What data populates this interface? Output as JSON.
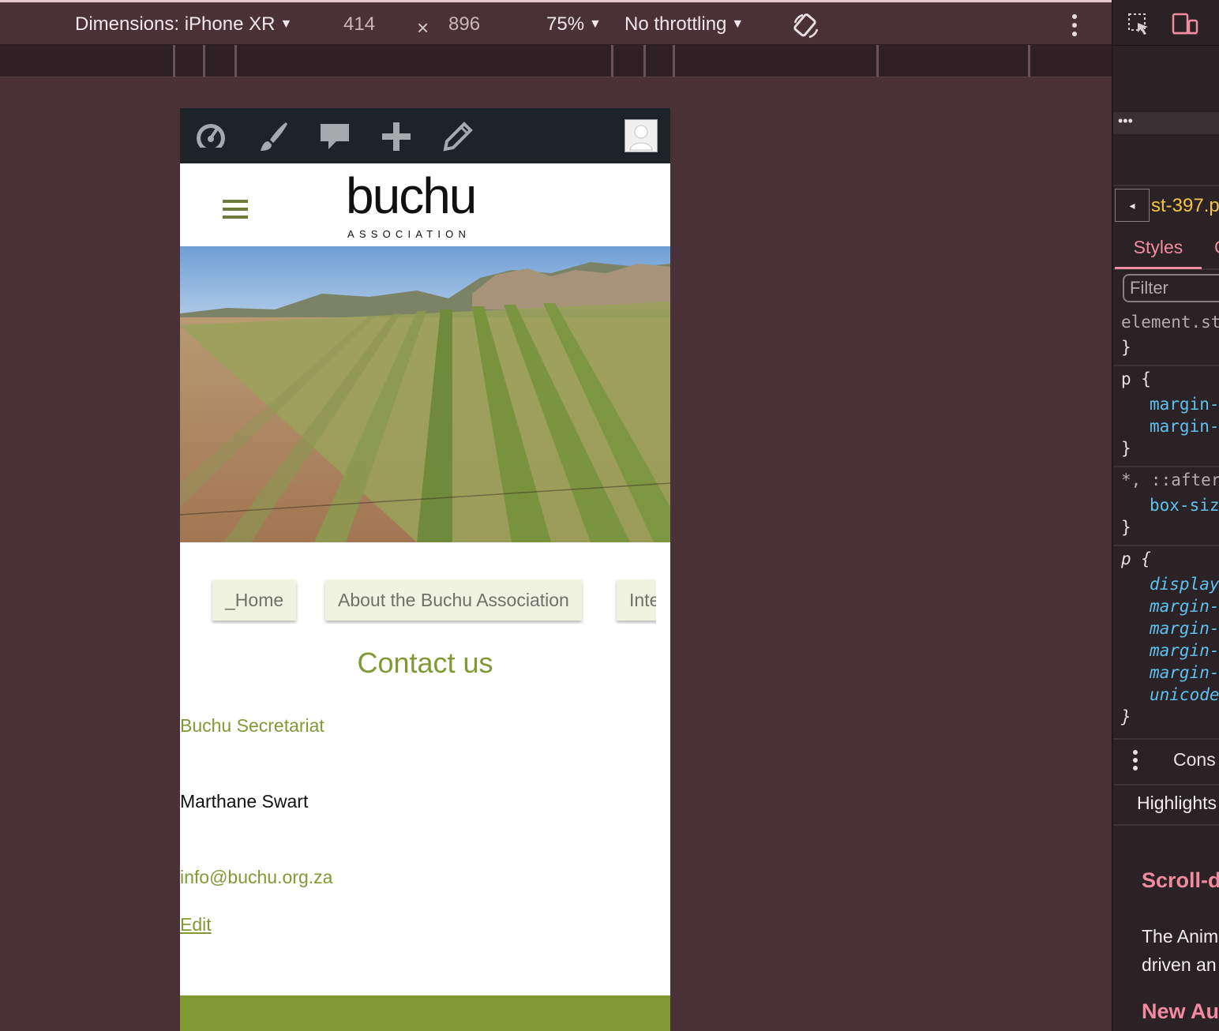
{
  "devtools_toolbar": {
    "dimensions_label": "Dimensions: iPhone XR",
    "width_value": "414",
    "times_symbol": "×",
    "height_value": "896",
    "zoom_label": "75%",
    "throttle_label": "No throttling",
    "caret": "▼"
  },
  "devtools_panel": {
    "ellipsis": "•••",
    "back_arrow": "◂",
    "file_name": "st-397.p",
    "tab_styles": "Styles",
    "tab_next": "C",
    "filter_placeholder": "Filter",
    "rules": {
      "r1_sel": "element.st",
      "r1_close": "}",
      "r2_sel": "p {",
      "r2_p1": "margin-",
      "r2_p2": "margin-",
      "r2_close": "}",
      "r3_sel": "*, ::after",
      "r3_p1": "box-siz",
      "r3_close": "}",
      "r4_sel": "p {",
      "r4_p1": "display",
      "r4_p2": "margin-",
      "r4_p3": "margin-",
      "r4_p4": "margin-",
      "r4_p5": "margin-",
      "r4_p6": "unicode",
      "r4_close": "}"
    },
    "console_label": "Cons",
    "highlights_label": "Highlights",
    "scroll_heading": "Scroll-d",
    "anim_line1": "The Anim",
    "anim_line2": "driven an",
    "new_heading": "New Au"
  },
  "site": {
    "logo_word": "buchu",
    "logo_sub": "ASSOCIATION",
    "nav": [
      "_Home",
      "About the Buchu Association",
      "International"
    ],
    "title": "Contact us",
    "secretariat": "Buchu Secretariat",
    "name": "Marthane Swart",
    "email": "info@buchu.org.za",
    "edit": "Edit"
  },
  "colors": {
    "accent_green": "#7f9a35",
    "admin_bar": "#1d2327",
    "devtools_bg": "#4a3138",
    "nav_button_bg": "#eff3df"
  },
  "icons": [
    "dashboard-icon",
    "customize-brush-icon",
    "comments-icon",
    "new-content-plus-icon",
    "edit-pencil-icon",
    "user-avatar-icon",
    "rotate-device-icon",
    "more-options-icon"
  ]
}
